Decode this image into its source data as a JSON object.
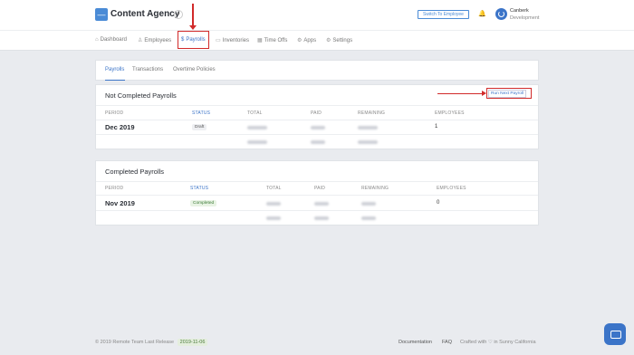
{
  "header": {
    "brand": "Content Agency",
    "switch_label": "Switch To Employee",
    "user_name": "Canberk",
    "user_org": "Development"
  },
  "nav": {
    "items": [
      {
        "label": "Dashboard",
        "icon": "dashboard-icon"
      },
      {
        "label": "Employees",
        "icon": "user-icon"
      },
      {
        "label": "Payrolls",
        "icon": "dollar-icon",
        "active": true
      },
      {
        "label": "Inventories",
        "icon": "inventory-icon"
      },
      {
        "label": "Time Offs",
        "icon": "calendar-icon"
      },
      {
        "label": "Apps",
        "icon": "apps-icon"
      },
      {
        "label": "Settings",
        "icon": "gear-icon"
      }
    ]
  },
  "tabs": [
    "Payrolls",
    "Transactions",
    "Overtime Policies"
  ],
  "not_completed": {
    "title": "Not Completed Payrolls",
    "run_label": "Run Next Payroll",
    "headers": {
      "period": "PERIOD",
      "status": "STATUS",
      "total": "TOTAL",
      "paid": "PAID",
      "remaining": "REMAINING",
      "employees": "EMPLOYEES"
    },
    "row": {
      "period": "Dec 2019",
      "status": "Draft",
      "employees": "1"
    }
  },
  "completed": {
    "title": "Completed Payrolls",
    "headers": {
      "period": "PERIOD",
      "status": "STATUS",
      "total": "TOTAL",
      "paid": "PAID",
      "remaining": "REMAINING",
      "employees": "EMPLOYEES"
    },
    "row": {
      "period": "Nov 2019",
      "status": "Completed",
      "employees": "0"
    }
  },
  "footer": {
    "copyright": "© 2019 Remote Team",
    "last_release_label": "Last Release",
    "release_date": "2019-11-06",
    "documentation": "Documentation",
    "faq": "FAQ",
    "crafted": "Crafted with ♡ in Sunny California"
  },
  "colors": {
    "accent": "#3b74c8",
    "highlight": "#d12a2a",
    "background": "#e9ebef"
  }
}
